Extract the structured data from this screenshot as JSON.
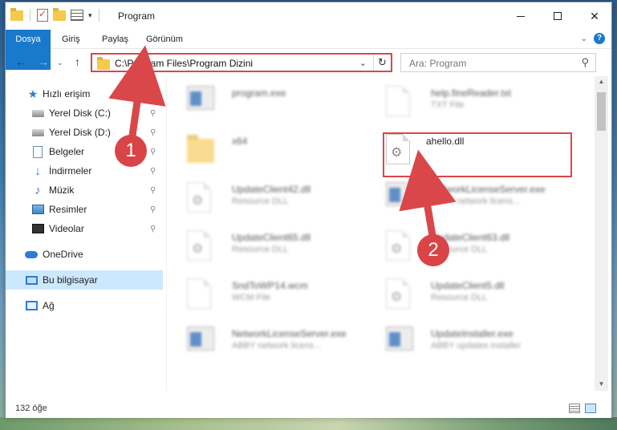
{
  "window": {
    "title": "Program",
    "close_glyph": "✕"
  },
  "ribbon": {
    "tabs": [
      "Dosya",
      "Giriş",
      "Paylaş",
      "Görünüm"
    ],
    "help_glyph": "?",
    "collapse_glyph": "⌄"
  },
  "navigation": {
    "back_glyph": "←",
    "forward_glyph": "→",
    "recent_glyph": "⌄",
    "up_glyph": "↑",
    "address": "C:\\Program Files\\Program Dizini",
    "address_dropdown_glyph": "⌄",
    "refresh_glyph": "↻",
    "search_placeholder": "Ara: Program",
    "search_glyph": "⚲"
  },
  "sidebar": {
    "pin_glyph": "📌",
    "items": [
      {
        "label": "Hızlı erişim",
        "icon": "star-icon",
        "pinned": false
      },
      {
        "label": "Yerel Disk (C:)",
        "icon": "drive-icon",
        "pinned": true
      },
      {
        "label": "Yerel Disk (D:)",
        "icon": "drive-icon",
        "pinned": true
      },
      {
        "label": "Belgeler",
        "icon": "documents-icon",
        "pinned": true
      },
      {
        "label": "İndirmeler",
        "icon": "downloads-icon",
        "pinned": true
      },
      {
        "label": "Müzik",
        "icon": "music-icon",
        "pinned": true
      },
      {
        "label": "Resimler",
        "icon": "pictures-icon",
        "pinned": true
      },
      {
        "label": "Videolar",
        "icon": "videos-icon",
        "pinned": true
      },
      {
        "label": "OneDrive",
        "icon": "cloud-icon",
        "pinned": false
      },
      {
        "label": "Bu bilgisayar",
        "icon": "computer-icon",
        "pinned": false,
        "selected": true
      },
      {
        "label": "Ağ",
        "icon": "network-icon",
        "pinned": false
      }
    ]
  },
  "files": [
    {
      "name": "program.exe",
      "desc": "",
      "icon": "exe-icon",
      "blurred": true
    },
    {
      "name": "help.fineReader.txt",
      "desc": "TXT File",
      "icon": "text-file-icon",
      "blurred": true
    },
    {
      "name": "x64",
      "desc": "",
      "icon": "folder-icon",
      "blurred": true
    },
    {
      "name": "ahello.dll",
      "desc": "",
      "icon": "dll-icon",
      "blurred": false
    },
    {
      "name": "UpdateClient42.dll",
      "desc": "Resource DLL",
      "icon": "dll-icon",
      "blurred": true
    },
    {
      "name": "NetworkLicenseServer.exe",
      "desc": "ABBY network licens...",
      "icon": "exe-icon",
      "blurred": true
    },
    {
      "name": "UpdateClient65.dll",
      "desc": "Resource DLL",
      "icon": "dll-icon",
      "blurred": true
    },
    {
      "name": "UpdateClient63.dll",
      "desc": "Resource DLL",
      "icon": "dll-icon",
      "blurred": true
    },
    {
      "name": "SndToWP14.wcm",
      "desc": "WCM File",
      "icon": "file-icon",
      "blurred": true
    },
    {
      "name": "UpdateClient5.dll",
      "desc": "Resource DLL",
      "icon": "dll-icon",
      "blurred": true
    },
    {
      "name": "NetworkLicenseServer.exe",
      "desc": "ABBY network licens...",
      "icon": "exe-icon",
      "blurred": true
    },
    {
      "name": "UpdateInstaller.exe",
      "desc": "ABBY updates installer",
      "icon": "exe-icon",
      "blurred": true
    }
  ],
  "status": {
    "item_count": "132 öğe"
  },
  "annotations": {
    "step1": "1",
    "step2": "2",
    "color": "#d9474a"
  }
}
